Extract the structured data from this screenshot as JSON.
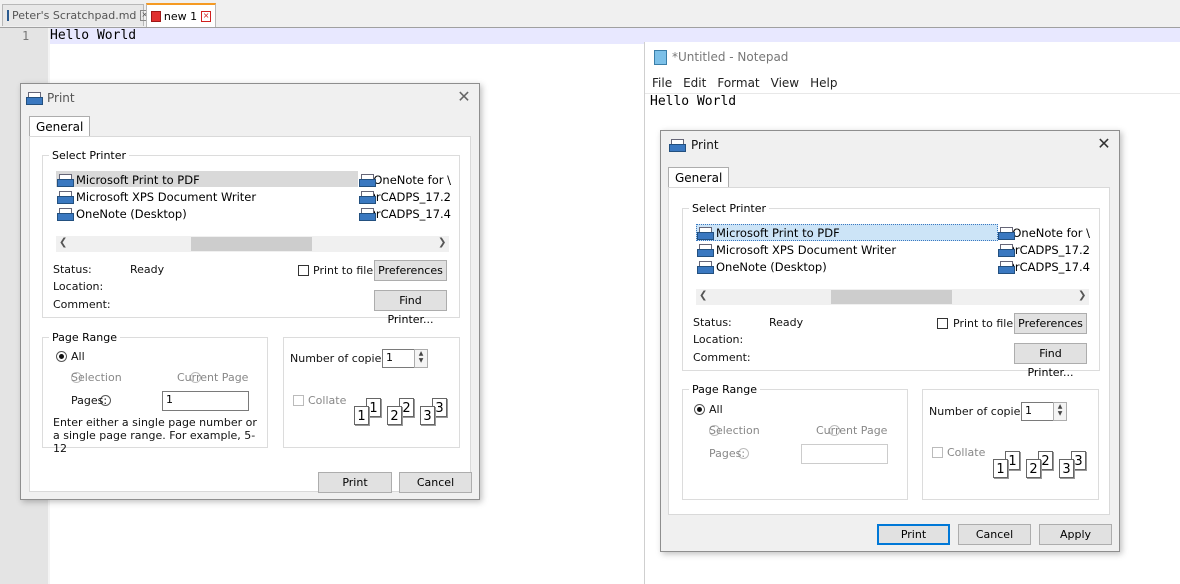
{
  "npp": {
    "tabs": [
      {
        "label": "Peter's Scratchpad.md",
        "close": "×"
      },
      {
        "label": "new 1",
        "close": "×"
      }
    ],
    "line_number": "1",
    "editor_text": "Hello World"
  },
  "notepad": {
    "title": "*Untitled - Notepad",
    "menu": [
      "File",
      "Edit",
      "Format",
      "View",
      "Help"
    ],
    "text": "Hello World"
  },
  "print_dialog_left": {
    "title": "Print",
    "close": "✕",
    "tab": "General",
    "select_printer_title": "Select Printer",
    "printers_col1": [
      "Microsoft Print to PDF",
      "Microsoft XPS Document Writer",
      "OneNote (Desktop)"
    ],
    "printers_col2": [
      "OneNote for \\",
      "OrCADPS_17.2",
      "OrCADPS_17.4"
    ],
    "status_label": "Status:",
    "status_value": "Ready",
    "location_label": "Location:",
    "comment_label": "Comment:",
    "print_to_file": "Print to file",
    "preferences": "Preferences",
    "find_printer": "Find Printer...",
    "page_range_title": "Page Range",
    "all": "All",
    "selection": "Selection",
    "current_page": "Current Page",
    "pages": "Pages:",
    "pages_value": "1",
    "hint": "Enter either a single page number or a single page range.  For example, 5-12",
    "copies_label": "Number of copies:",
    "copies_value": "1",
    "collate": "Collate",
    "print": "Print",
    "cancel": "Cancel"
  },
  "print_dialog_right": {
    "title": "Print",
    "close": "✕",
    "tab": "General",
    "select_printer_title": "Select Printer",
    "printers_col1": [
      "Microsoft Print to PDF",
      "Microsoft XPS Document Writer",
      "OneNote (Desktop)"
    ],
    "printers_col2": [
      "OneNote for \\",
      "OrCADPS_17.2",
      "OrCADPS_17.4"
    ],
    "status_label": "Status:",
    "status_value": "Ready",
    "location_label": "Location:",
    "comment_label": "Comment:",
    "print_to_file": "Print to file",
    "preferences": "Preferences",
    "find_printer": "Find Printer...",
    "page_range_title": "Page Range",
    "all": "All",
    "selection": "Selection",
    "current_page": "Current Page",
    "pages": "Pages:",
    "pages_value": "",
    "copies_label": "Number of copies:",
    "copies_value": "1",
    "collate": "Collate",
    "print": "Print",
    "cancel": "Cancel",
    "apply": "Apply"
  },
  "collate_pages": [
    "1",
    "1",
    "2",
    "2",
    "3",
    "3"
  ]
}
